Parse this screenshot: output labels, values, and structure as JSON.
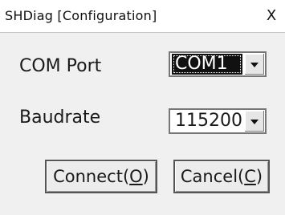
{
  "window": {
    "title": "SHDiag [Configuration]",
    "close_label": "X"
  },
  "com_port": {
    "label": "COM Port",
    "value": "COM1"
  },
  "baudrate": {
    "label": "Baudrate",
    "value": "115200"
  },
  "buttons": {
    "connect_prefix": "Connect(",
    "connect_key": "O",
    "connect_suffix": ")",
    "cancel_prefix": "Cancel(",
    "cancel_key": "C",
    "cancel_suffix": ")"
  }
}
